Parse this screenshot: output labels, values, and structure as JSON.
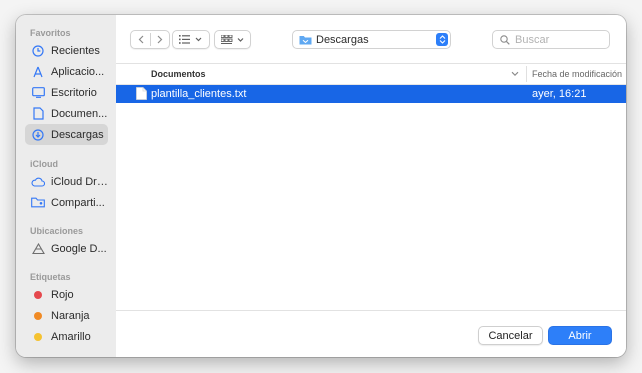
{
  "sidebar": {
    "sections": [
      {
        "title": "Favoritos",
        "items": [
          {
            "label": "Recientes",
            "icon": "clock-icon"
          },
          {
            "label": "Aplicacio...",
            "icon": "applications-icon"
          },
          {
            "label": "Escritorio",
            "icon": "desktop-icon"
          },
          {
            "label": "Documen...",
            "icon": "document-icon"
          },
          {
            "label": "Descargas",
            "icon": "download-icon",
            "selected": true
          }
        ]
      },
      {
        "title": "iCloud",
        "items": [
          {
            "label": "iCloud Dri...",
            "icon": "cloud-icon"
          },
          {
            "label": "Comparti...",
            "icon": "shared-folder-icon"
          }
        ]
      },
      {
        "title": "Ubicaciones",
        "items": [
          {
            "label": "Google D...",
            "icon": "drive-icon"
          }
        ]
      },
      {
        "title": "Etiquetas",
        "items": [
          {
            "label": "Rojo",
            "color": "#e5484d"
          },
          {
            "label": "Naranja",
            "color": "#f08a24"
          },
          {
            "label": "Amarillo",
            "color": "#f5c230"
          }
        ]
      }
    ]
  },
  "toolbar": {
    "location": "Descargas",
    "search_placeholder": "Buscar"
  },
  "columns": {
    "name": "Documentos",
    "date": "Fecha de modificación"
  },
  "files": [
    {
      "name": "plantilla_clientes.txt",
      "date": "ayer, 16:21",
      "selected": true
    }
  ],
  "footer": {
    "cancel_label": "Cancelar",
    "open_label": "Abrir"
  },
  "colors": {
    "accent": "#2d7ff9",
    "selection": "#1866e6",
    "sidebar_bg": "#ececec"
  }
}
